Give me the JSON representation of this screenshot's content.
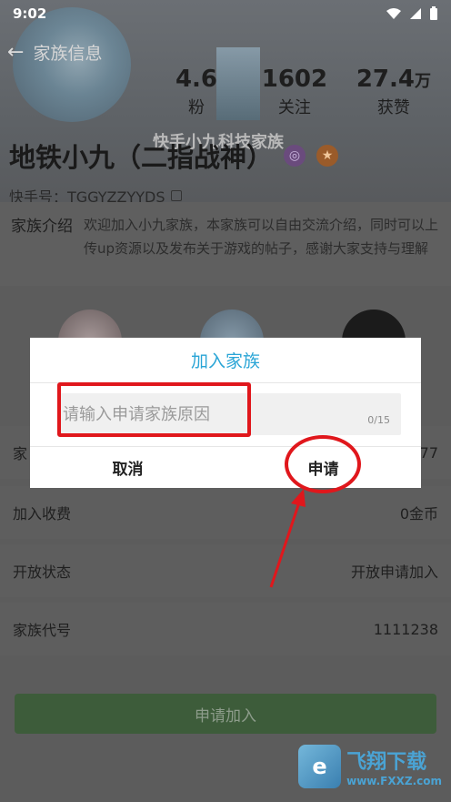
{
  "status_bar": {
    "time": "9:02"
  },
  "header": {
    "title": "家族信息",
    "stats": [
      {
        "value": "4.6",
        "label": "粉"
      },
      {
        "value": "1602",
        "label": "关注"
      },
      {
        "value": "27.4",
        "unit": "万",
        "label": "获赞"
      }
    ],
    "ribbon": "快手小九科技家族",
    "name": "地铁小九（二指战神）",
    "kuaishou_id": "快手号：TGGYZZYYDS"
  },
  "intro": {
    "label": "家族介绍",
    "text": "欢迎加入小九家族，本家族可以自由交流介绍，同时可以上传up资源以及发布关于游戏的帖子，感谢大家支持与理解"
  },
  "rows": {
    "hidden": {
      "label": "家",
      "value": "77"
    },
    "fee": {
      "label": "加入收费",
      "value": "0金币"
    },
    "open": {
      "label": "开放状态",
      "value": "开放申请加入"
    },
    "code": {
      "label": "家族代号",
      "value": "1111238"
    }
  },
  "apply_button": "申请加入",
  "dialog": {
    "title": "加入家族",
    "placeholder": "请输入申请家族原因",
    "counter": "0/15",
    "cancel": "取消",
    "confirm": "申请"
  },
  "watermark": {
    "name": "飞翔下载",
    "url": "www.FXXZ.com"
  },
  "colors": {
    "dialog_accent": "#2aa5d6",
    "annotation": "#e0171c",
    "apply_green": "#3d5c3a"
  }
}
